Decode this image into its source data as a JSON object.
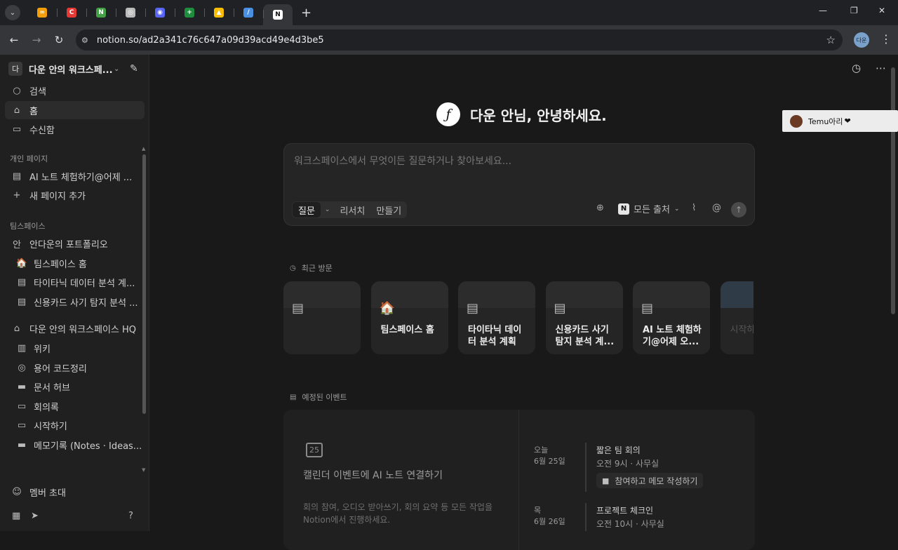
{
  "browser": {
    "tabs": [
      {
        "icon": "infinity-icon",
        "color": "#f59e0b",
        "glyph": "∞"
      },
      {
        "icon": "c-app-icon",
        "color": "#e53935",
        "glyph": "C"
      },
      {
        "icon": "n-app-icon",
        "color": "#43a047",
        "glyph": "N"
      },
      {
        "icon": "openai-icon",
        "color": "#bbbbbb",
        "glyph": "◎"
      },
      {
        "icon": "discord-icon",
        "color": "#5865f2",
        "glyph": "◉"
      },
      {
        "icon": "sheets-icon",
        "color": "#1e8e3e",
        "glyph": "+"
      },
      {
        "icon": "drive-icon",
        "color": "#fbbc04",
        "glyph": "▲"
      },
      {
        "icon": "perplexity-icon",
        "color": "#4a90e2",
        "glyph": "/"
      },
      {
        "icon": "notion-icon",
        "color": "#ffffff",
        "glyph": "N"
      }
    ],
    "url": "notion.so/ad2a341c76c647a09d39acd49e4d3be5",
    "profile_label": "다운"
  },
  "sidebar": {
    "workspace_badge": "다",
    "workspace_name": "다운 안의 워크스페...",
    "top_items": [
      {
        "label": "검색",
        "icon": "search-icon",
        "glyph": "○"
      },
      {
        "label": "홈",
        "icon": "home-icon",
        "glyph": "⌂"
      },
      {
        "label": "수신함",
        "icon": "inbox-icon",
        "glyph": "▭"
      }
    ],
    "personal_section": "개인 페이지",
    "personal_items": [
      {
        "label": "AI 노트 체험하기@어제 ...",
        "icon": "page-icon",
        "glyph": "▤"
      },
      {
        "label": "새 페이지 추가",
        "icon": "plus-icon",
        "glyph": "+"
      }
    ],
    "team_section": "팀스페이스",
    "team_items": [
      {
        "label": "안다운의 포트폴리오",
        "icon": "badge-icon",
        "glyph": "안",
        "indent": false
      },
      {
        "label": "팀스페이스 홈",
        "icon": "house-emoji-icon",
        "glyph": "🏠",
        "indent": true
      },
      {
        "label": "타이타닉 데이터 분석 계...",
        "icon": "page-icon",
        "glyph": "▤",
        "indent": true
      },
      {
        "label": "신용카드 사기 탐지 분석 ...",
        "icon": "page-icon",
        "glyph": "▤",
        "indent": true
      },
      {
        "label": "다운 안의 워크스페이스 HQ",
        "icon": "home-badge-icon",
        "glyph": "⌂",
        "indent": false
      },
      {
        "label": "위키",
        "icon": "book-icon",
        "glyph": "▥",
        "indent": true
      },
      {
        "label": "용어 코드정리",
        "icon": "circle-icon",
        "glyph": "◎",
        "indent": true
      },
      {
        "label": "문서 허브",
        "icon": "doc-icon",
        "glyph": "▬",
        "indent": true
      },
      {
        "label": "회의록",
        "icon": "folder-icon",
        "glyph": "▭",
        "indent": true
      },
      {
        "label": "시작하기",
        "icon": "laptop-icon",
        "glyph": "▭",
        "indent": true
      },
      {
        "label": "메모기록 (Notes · Ideas...",
        "icon": "note-icon",
        "glyph": "▬",
        "indent": true
      }
    ],
    "invite_label": "멤버 초대"
  },
  "main": {
    "greeting": "다운 안님, 안녕하세요.",
    "ask": {
      "placeholder": "워크스페이스에서 무엇이든 질문하거나 찾아보세요...",
      "modes": [
        "질문",
        "리서치",
        "만들기"
      ],
      "source_label": "모든 출처"
    },
    "recent_heading": "최근 방문",
    "recent_cards": [
      {
        "title": "",
        "icon": "page-icon",
        "glyph": "▤"
      },
      {
        "title": "팀스페이스 홈",
        "icon": "house-emoji-icon",
        "glyph": "🏠"
      },
      {
        "title": "타이타닉 데이터 분석 계획 ...",
        "icon": "page-icon",
        "glyph": "▤"
      },
      {
        "title": "신용카드 사기 탐지 분석 계...",
        "icon": "page-icon",
        "glyph": "▤"
      },
      {
        "title": "AI 노트 체험하기@어제 오...",
        "icon": "page-icon",
        "glyph": "▤"
      },
      {
        "title": "시작하",
        "icon": "image-cover-icon",
        "glyph": ""
      }
    ],
    "events_heading": "예정된 이벤트",
    "calendar_day": "25",
    "calendar_title": "캘린더 이벤트에 AI 노트 연결하기",
    "calendar_desc": "회의 참여, 오디오 받아쓰기, 회의 요약 등 모든 작업을 Notion에서 진행하세요.",
    "events": [
      {
        "day": "오늘",
        "date": "6월 25일",
        "name": "짧은 팀 회의",
        "time": "오전 9시 · 사무실",
        "action": "참여하고 메모 작성하기"
      },
      {
        "day": "목",
        "date": "6월 26일",
        "name": "프로젝트 체크인",
        "time": "오전 10시 · 사무실",
        "action": ""
      }
    ]
  },
  "floating_user": {
    "name": "Temu아리",
    "heart": "❤"
  }
}
